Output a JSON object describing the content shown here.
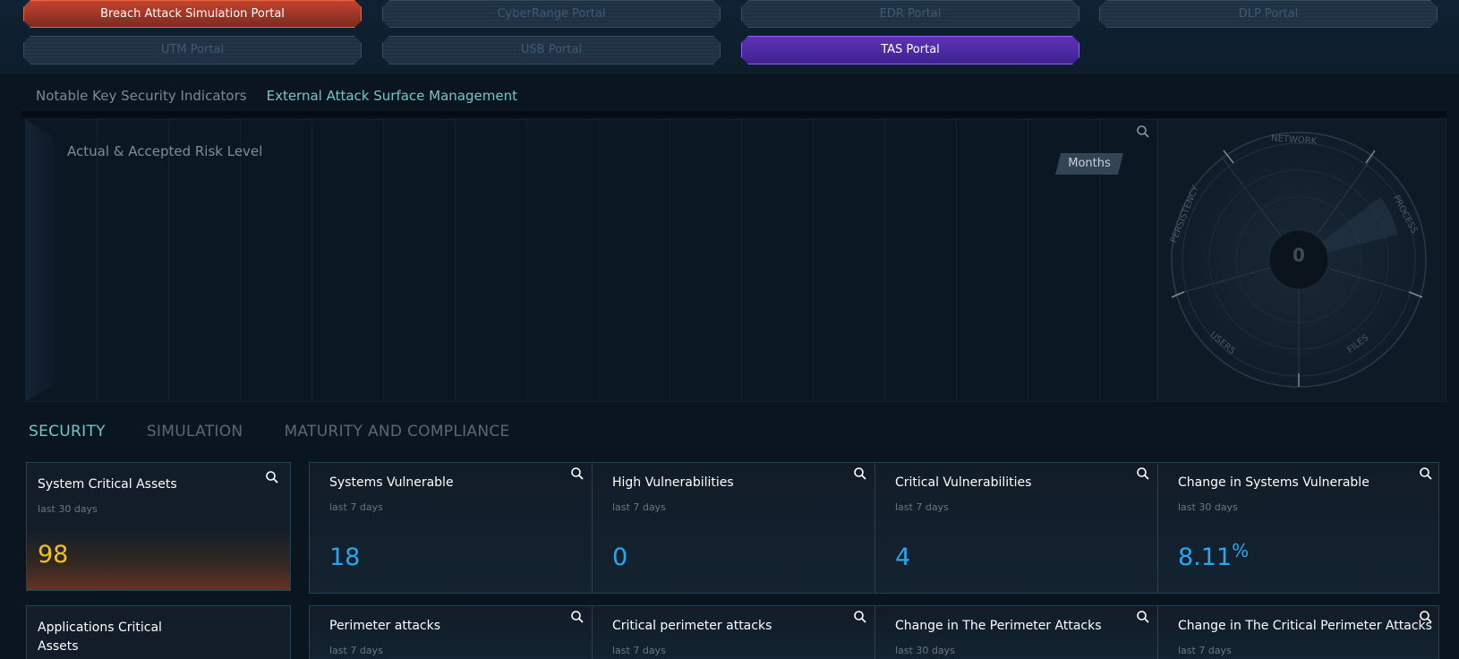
{
  "portals": [
    {
      "label": "Breach Attack Simulation Portal",
      "style": "red"
    },
    {
      "label": "CyberRange Portal",
      "style": "disabled"
    },
    {
      "label": "EDR Portal",
      "style": "disabled"
    },
    {
      "label": "DLP Portal",
      "style": "disabled"
    },
    {
      "label": "UTM Portal",
      "style": "disabled"
    },
    {
      "label": "USB Portal",
      "style": "disabled"
    },
    {
      "label": "TAS Portal",
      "style": "purple"
    }
  ],
  "top_tabs": [
    {
      "label": "Notable Key Security Indicators",
      "active": false
    },
    {
      "label": "External Attack Surface Management",
      "active": true
    }
  ],
  "risk_chart": {
    "title": "Actual & Accepted Risk Level",
    "period_button": "Months"
  },
  "radar": {
    "center_value": "0",
    "labels": [
      "NETWORK",
      "PROCESS",
      "FILES",
      "USERS",
      "PERSISTENCY"
    ]
  },
  "section_tabs": [
    {
      "label": "SECURITY",
      "active": true
    },
    {
      "label": "SIMULATION",
      "active": false
    },
    {
      "label": "MATURITY AND COMPLIANCE",
      "active": false
    }
  ],
  "row1": {
    "feature": {
      "title": "System Critical Assets",
      "period": "last 30 days",
      "value": "98"
    },
    "cells": [
      {
        "title": "Systems Vulnerable",
        "period": "last 7 days",
        "value": "18",
        "unit": ""
      },
      {
        "title": "High Vulnerabilities",
        "period": "last 7 days",
        "value": "0",
        "unit": ""
      },
      {
        "title": "Critical Vulnerabilities",
        "period": "last 7 days",
        "value": "4",
        "unit": ""
      },
      {
        "title": "Change in Systems Vulnerable",
        "period": "last 30 days",
        "value": "8.11",
        "unit": "%"
      }
    ]
  },
  "row2": {
    "feature": {
      "title_line1": "Applications Critical",
      "title_line2": "Assets"
    },
    "cells": [
      {
        "title": "Perimeter attacks",
        "period": "last 7 days"
      },
      {
        "title": "Critical perimeter attacks",
        "period": "last 7 days"
      },
      {
        "title": "Change in The Perimeter Attacks",
        "period": "last 30 days"
      },
      {
        "title": "Change in The Critical Perimeter Attacks",
        "period": "last 7 days"
      }
    ]
  },
  "colors": {
    "accent_teal": "#6ec8c4",
    "value_blue": "#2aa6ee",
    "value_yellow": "#f1c21a",
    "portal_red": "#c2432e",
    "portal_purple": "#5e32b6"
  }
}
